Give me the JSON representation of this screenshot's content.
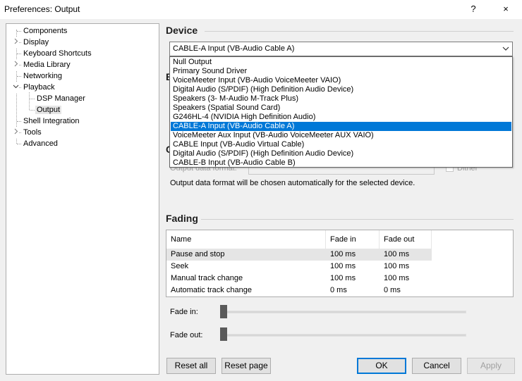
{
  "window": {
    "title": "Preferences: Output",
    "help_glyph": "?",
    "close_glyph": "×"
  },
  "tree": {
    "items": [
      {
        "label": "Components",
        "expandable": false
      },
      {
        "label": "Display",
        "expandable": true
      },
      {
        "label": "Keyboard Shortcuts",
        "expandable": false
      },
      {
        "label": "Media Library",
        "expandable": true
      },
      {
        "label": "Networking",
        "expandable": false
      },
      {
        "label": "Playback",
        "expandable": true,
        "expanded": true
      },
      {
        "label": "DSP Manager",
        "child": true
      },
      {
        "label": "Output",
        "child": true,
        "selected": true
      },
      {
        "label": "Shell Integration",
        "expandable": false
      },
      {
        "label": "Tools",
        "expandable": true
      },
      {
        "label": "Advanced",
        "expandable": false
      }
    ]
  },
  "device": {
    "section_title": "Device",
    "selected": "CABLE-A Input (VB-Audio Cable A)",
    "options": [
      "Null Output",
      "Primary Sound Driver",
      "VoiceMeeter Input (VB-Audio VoiceMeeter VAIO)",
      "Digital Audio (S/PDIF) (High Definition Audio Device)",
      "Speakers (3- M-Audio M-Track Plus)",
      "Speakers (Spatial Sound Card)",
      "G246HL-4 (NVIDIA High Definition Audio)",
      "CABLE-A Input (VB-Audio Cable A)",
      "VoiceMeeter Aux Input (VB-Audio VoiceMeeter AUX VAIO)",
      "CABLE Input (VB-Audio Virtual Cable)",
      "Digital Audio (S/PDIF) (High Definition Audio Device)",
      "CABLE-B Input (VB-Audio Cable B)"
    ],
    "selected_index": 7
  },
  "output_format": {
    "label": "Output data format:",
    "dither_label": "Dither",
    "description": "Output data format will be chosen automatically for the selected device."
  },
  "fading": {
    "section_title": "Fading",
    "columns": [
      "Name",
      "Fade in",
      "Fade out"
    ],
    "rows": [
      {
        "name": "Pause and stop",
        "fade_in": "100 ms",
        "fade_out": "100 ms",
        "highlighted": true
      },
      {
        "name": "Seek",
        "fade_in": "100 ms",
        "fade_out": "100 ms"
      },
      {
        "name": "Manual track change",
        "fade_in": "100 ms",
        "fade_out": "100 ms"
      },
      {
        "name": "Automatic track change",
        "fade_in": "0 ms",
        "fade_out": "0 ms"
      }
    ],
    "fade_in_label": "Fade in:",
    "fade_out_label": "Fade out:",
    "fade_in_level": 0,
    "fade_out_level": 0
  },
  "buttons": {
    "reset_all": "Reset all",
    "reset_page": "Reset page",
    "ok": "OK",
    "cancel": "Cancel",
    "apply": "Apply"
  }
}
